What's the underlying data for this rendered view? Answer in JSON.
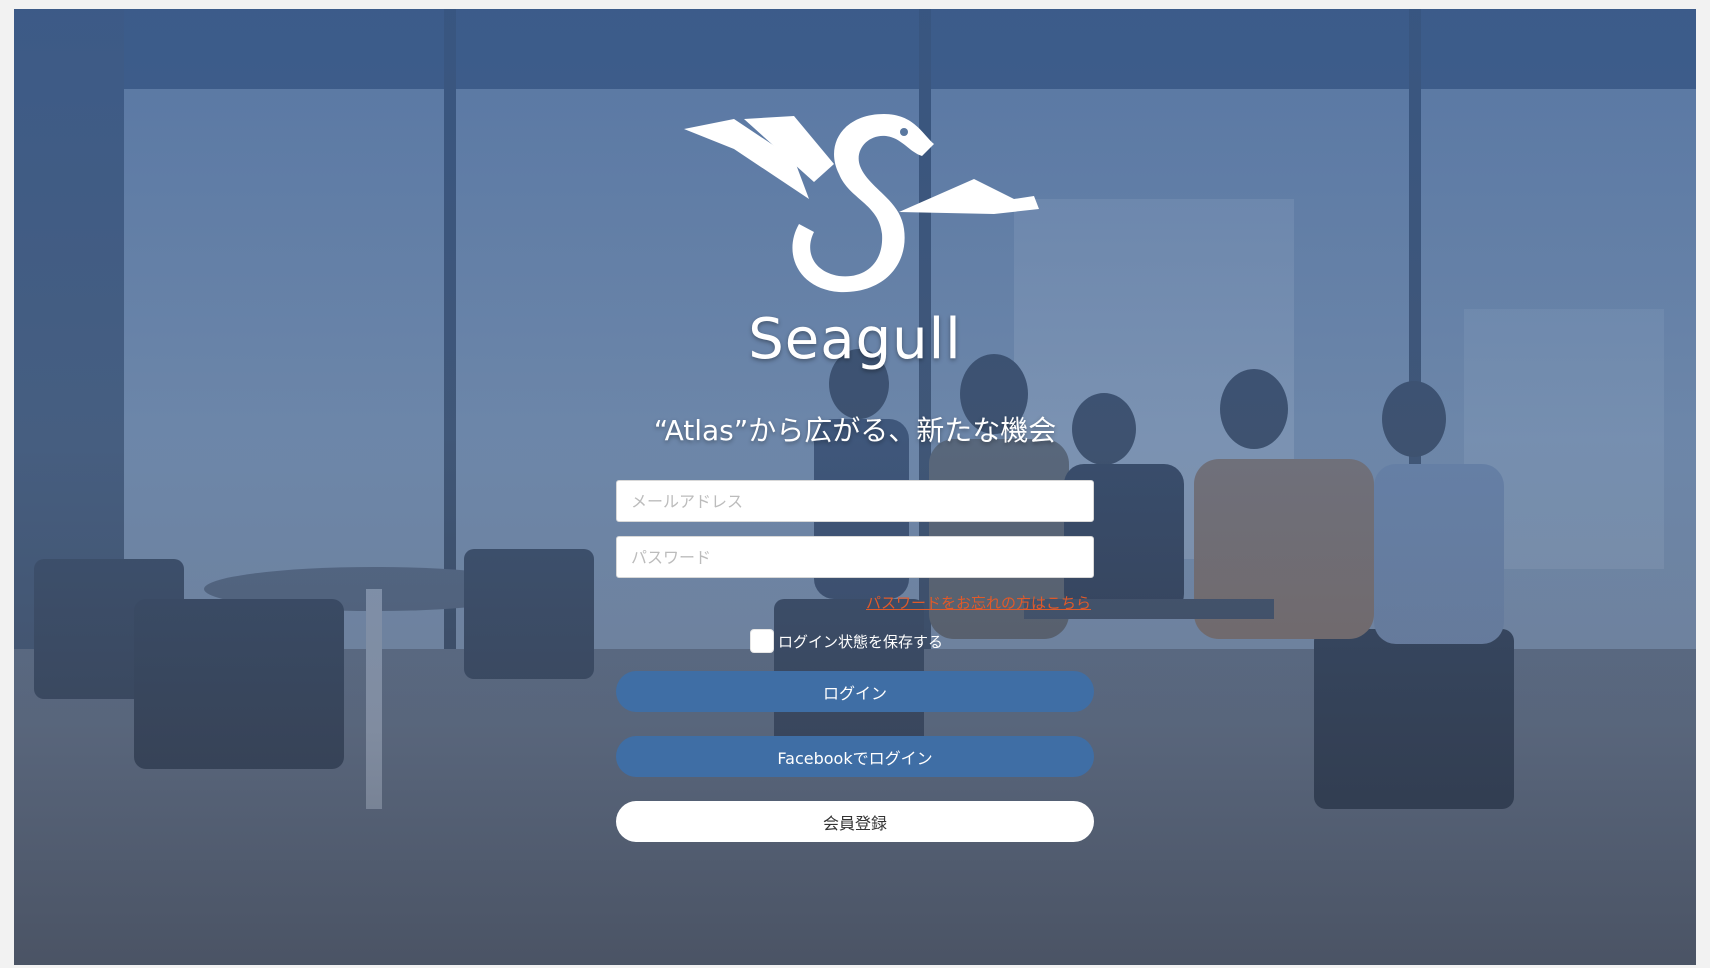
{
  "brand": {
    "name": "Seagull",
    "logo_icon": "seagull-logo-icon"
  },
  "tagline": "“Atlas”から広がる、新たな機会",
  "form": {
    "email_placeholder": "メールアドレス",
    "password_placeholder": "パスワード",
    "forgot_password": "パスワードをお忘れの方はこちら",
    "remember_label": "ログイン状態を保存する",
    "remember_checked": false,
    "login_button": "ログイン",
    "facebook_button": "Facebookでログイン",
    "register_button": "会員登録"
  },
  "colors": {
    "primary_button": "#3f6ea5",
    "link": "#e05a2a",
    "overlay": "#3c6096"
  }
}
